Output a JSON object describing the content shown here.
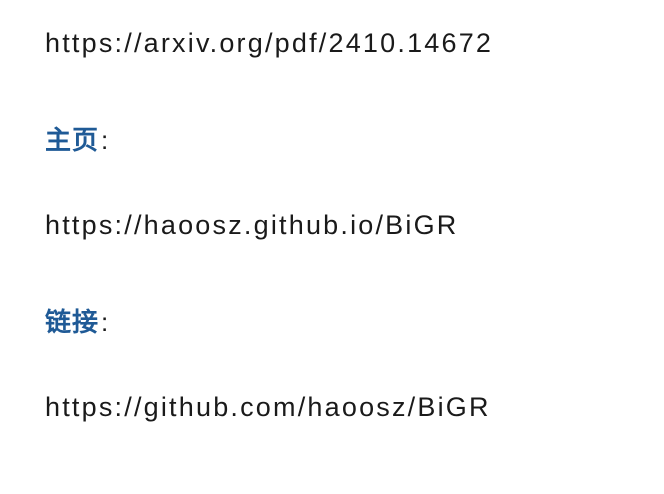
{
  "document": {
    "paper_url": "https://arxiv.org/pdf/2410.14672",
    "homepage": {
      "label": "主页",
      "colon": ":",
      "url": "https://haoosz.github.io/BiGR"
    },
    "link": {
      "label": "链接",
      "colon": ":",
      "url": "https://github.com/haoosz/BiGR"
    }
  },
  "colors": {
    "heading": "#1f5a96",
    "text": "#1a1a1a",
    "background": "#ffffff"
  }
}
